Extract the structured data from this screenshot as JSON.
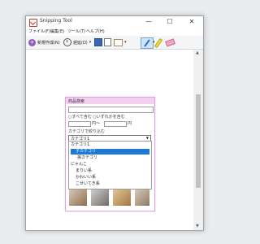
{
  "window": {
    "title": "Snipping Tool",
    "controls": {
      "minimize": "—",
      "maximize": "☐",
      "close": "✕"
    }
  },
  "menubar": [
    "ファイル(F)",
    "編集(E)",
    "ツール(T)",
    "ヘルプ(H)"
  ],
  "toolbar": {
    "new_label": "新規作成(N)",
    "delay_label": "遅延(D)"
  },
  "capture": {
    "title": "商品検索",
    "search_option": "すべて含む",
    "search_option_2": "いずれかを含む",
    "price_unit_1": "円〜",
    "price_unit_2": "円",
    "category_label": "カテゴリで絞り込む",
    "select_value": "カテゴリ1",
    "dropdown_items": [
      "カテゴリ1",
      "子カテゴリ",
      "孫カテゴリ",
      "にゃんこ",
      "まりい系",
      "かわいい系",
      "こせいてき系"
    ],
    "selected_index": 1
  },
  "colors": {
    "accent": "#1e78d6",
    "capture_border": "#e0a3e0",
    "capture_head": "#f3cff0"
  },
  "icons": [
    "app-icon",
    "new-snip-icon",
    "clock-icon",
    "save-icon",
    "copy-icon",
    "send-icon",
    "pen-icon",
    "highlighter-icon",
    "eraser-icon"
  ]
}
